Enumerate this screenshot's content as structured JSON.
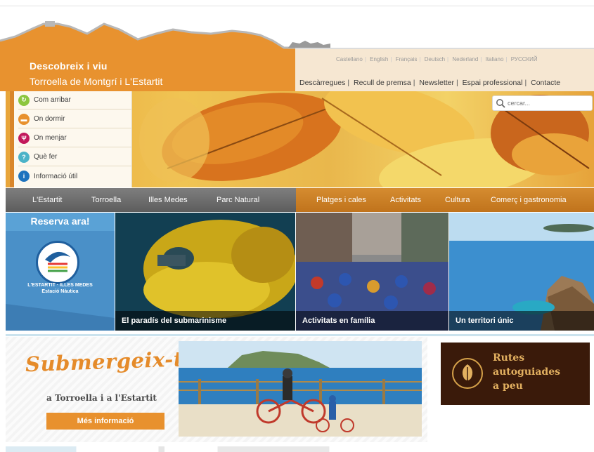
{
  "header": {
    "brand_line1": "Descobreix i viu",
    "brand_line2": "Torroella de Montgrí i L'Estartit",
    "languages": [
      "Castellano",
      "English",
      "Français",
      "Deutsch",
      "Nederland",
      "Italiano",
      "РУССКИЙ"
    ],
    "links": [
      "Descàrregues",
      "Recull de premsa",
      "Newsletter",
      "Espai professional",
      "Contacte"
    ]
  },
  "quick_links": [
    {
      "label": "Com arribar",
      "icon": "route-icon",
      "color": "#8cc63f"
    },
    {
      "label": "On dormir",
      "icon": "bed-icon",
      "color": "#e8912e"
    },
    {
      "label": "On menjar",
      "icon": "cutlery-icon",
      "color": "#c2185b"
    },
    {
      "label": "Què fer",
      "icon": "question-icon",
      "color": "#4bb3c8"
    },
    {
      "label": "Informació útil",
      "icon": "info-icon",
      "color": "#1e73be"
    }
  ],
  "search": {
    "placeholder": "cercar..."
  },
  "nav_left": [
    "L'Estartit",
    "Torroella",
    "Illes Medes",
    "Parc Natural"
  ],
  "nav_right": [
    "Platges i cales",
    "Activitats",
    "Cultura",
    "Comerç i gastronomia"
  ],
  "reserva": {
    "title": "Reserva ara!",
    "line1": "L'ESTARTIT · ILLES MEDES",
    "line2": "Estació Nàutica"
  },
  "tiles": [
    {
      "caption": "El paradís del submarinisme"
    },
    {
      "caption": "Activitats en família"
    },
    {
      "caption": "Un territori únic"
    }
  ],
  "promo": {
    "headline": "Submergeix-te",
    "subline": "a Torroella i a l'Estartit",
    "button": "Més informació"
  },
  "rutes": {
    "line1": "Rutes",
    "line2": "autoguiades",
    "line3": "a peu"
  },
  "colors": {
    "orange": "#e8912e",
    "nav_gray": "#6e6e6e",
    "nav_orange": "#c97d25",
    "blue": "#4a90c8"
  }
}
